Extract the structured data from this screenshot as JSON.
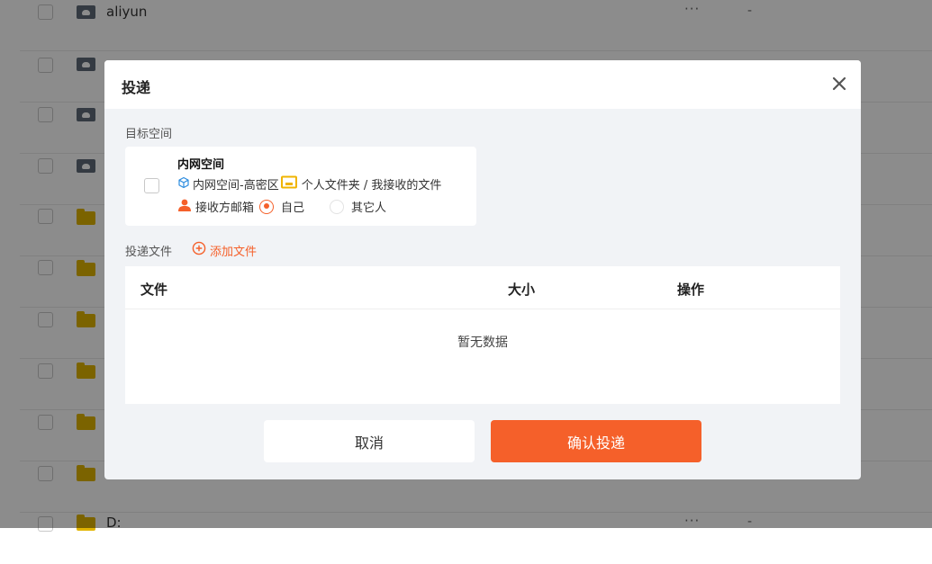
{
  "file_list": {
    "rows": [
      {
        "type": "cloud",
        "name": "aliyun",
        "more": "···",
        "size": "-"
      },
      {
        "type": "cloud",
        "name": "",
        "more": "",
        "size": ""
      },
      {
        "type": "cloud",
        "name": "",
        "more": "",
        "size": ""
      },
      {
        "type": "cloud",
        "name": "",
        "more": "",
        "size": ""
      },
      {
        "type": "folder",
        "name": "",
        "more": "",
        "size": ""
      },
      {
        "type": "folder",
        "name": "",
        "more": "",
        "size": ""
      },
      {
        "type": "folder",
        "name": "",
        "more": "",
        "size": ""
      },
      {
        "type": "folder",
        "name": "",
        "more": "",
        "size": ""
      },
      {
        "type": "folder",
        "name": "",
        "more": "",
        "size": ""
      },
      {
        "type": "folder",
        "name": "",
        "more": "",
        "size": ""
      },
      {
        "type": "folder",
        "name": "D:",
        "more": "···",
        "size": "-"
      }
    ]
  },
  "modal": {
    "title": "投递",
    "target_label": "目标空间",
    "space_name": "内网空间",
    "space_path": "内网空间-高密区",
    "folder_path": "个人文件夹 / 我接收的文件",
    "receiver_label": "接收方邮箱",
    "option_self": "自己",
    "option_others": "其它人",
    "selected_option": "self",
    "files_label": "投递文件",
    "add_file": "添加文件",
    "table": {
      "col_file": "文件",
      "col_size": "大小",
      "col_action": "操作",
      "empty_text": "暂无数据"
    },
    "cancel": "取消",
    "confirm": "确认投递"
  },
  "colors": {
    "accent": "#f5602a",
    "blue_icon": "#2f8ee0",
    "folder_icon": "#f0b400",
    "person_icon": "#f5602a"
  },
  "icons": {
    "close": "close-icon",
    "cube": "cube-icon",
    "folder": "folder-icon",
    "person": "person-icon",
    "add": "plus-circle-icon"
  }
}
